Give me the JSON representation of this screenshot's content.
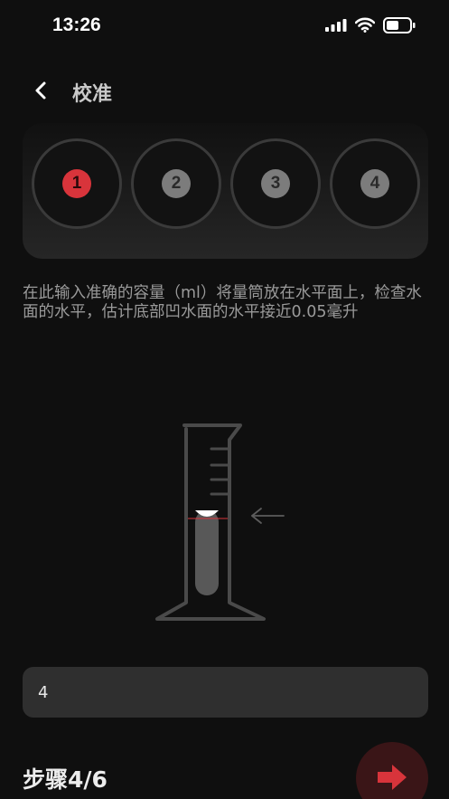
{
  "status_bar": {
    "time": "13:26"
  },
  "nav": {
    "title": "校准"
  },
  "steps": [
    {
      "label": "1",
      "active": true
    },
    {
      "label": "2",
      "active": false
    },
    {
      "label": "3",
      "active": false
    },
    {
      "label": "4",
      "active": false
    }
  ],
  "instruction": "在此输入准确的容量（ml）将量筒放在水平面上，检查水面的水平，估计底部凹水面的水平接近0.05毫升",
  "volume_input": {
    "value": "4"
  },
  "footer": {
    "step_progress": "步骤4/6"
  },
  "colors": {
    "accent": "#d8343b",
    "background": "#0f0f0f",
    "input_bg": "#2f2f2f"
  },
  "icons": {
    "back": "chevron-left-icon",
    "next": "arrow-right-icon",
    "indicator": "arrow-left-icon"
  }
}
